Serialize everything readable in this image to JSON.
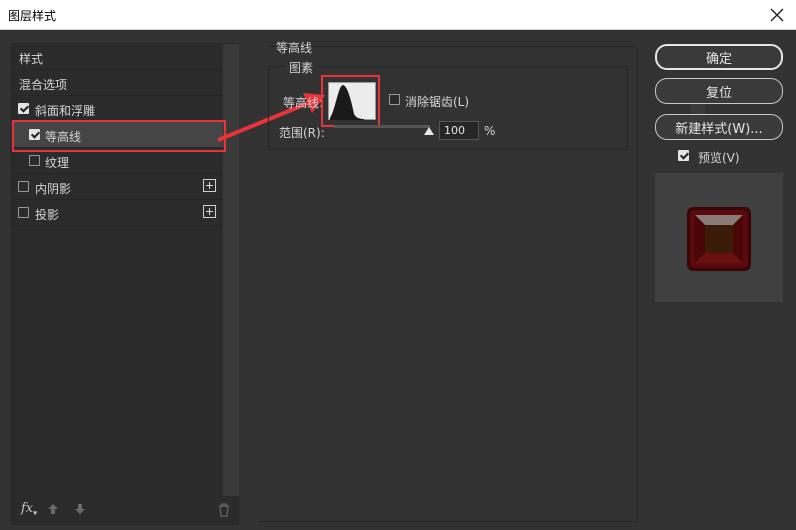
{
  "window": {
    "title": "图层样式"
  },
  "left_panel": {
    "items": [
      {
        "label": "样式",
        "has_checkbox": false,
        "checked": false
      },
      {
        "label": "混合选项",
        "has_checkbox": false,
        "checked": false
      },
      {
        "label": "斜面和浮雕",
        "has_checkbox": true,
        "checked": true
      },
      {
        "label": "等高线",
        "has_checkbox": true,
        "checked": true,
        "selected": true
      },
      {
        "label": "纹理",
        "has_checkbox": true,
        "checked": false
      },
      {
        "label": "内阴影",
        "has_checkbox": true,
        "checked": false,
        "has_add": true
      },
      {
        "label": "投影",
        "has_checkbox": true,
        "checked": false,
        "has_add": true
      }
    ],
    "fx_label": "fx"
  },
  "contour": {
    "group_title": "等高线",
    "fieldset_title": "图素",
    "contour_label": "等高线:",
    "anti_alias_label": "消除锯齿(L)",
    "anti_alias_checked": false,
    "range_label": "范围(R):",
    "range_value": "100",
    "range_unit": "%"
  },
  "buttons": {
    "ok": "确定",
    "reset": "复位",
    "new_style": "新建样式(W)..."
  },
  "preview": {
    "label": "预览(V)",
    "checked": true
  },
  "colors": {
    "annotation_red": "#e8333a",
    "panel_bg": "#323232"
  }
}
